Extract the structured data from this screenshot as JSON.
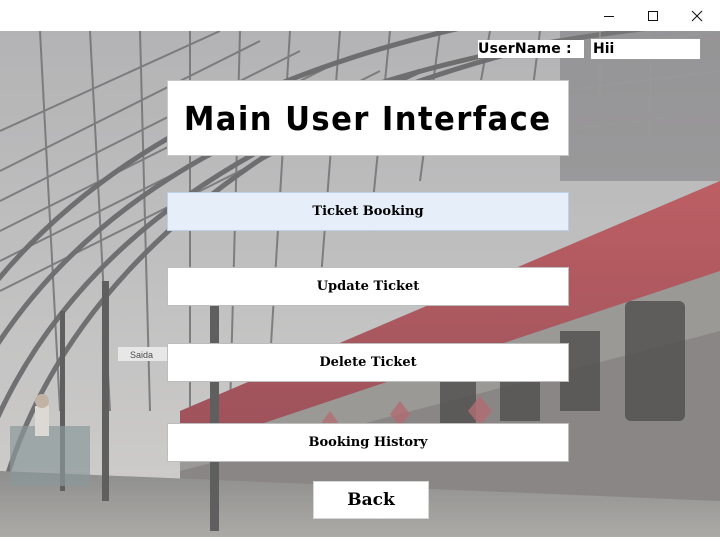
{
  "window": {
    "controls": {
      "minimize_icon": "minimize-icon",
      "maximize_icon": "maximize-icon",
      "close_icon": "close-icon"
    }
  },
  "header": {
    "username_label": "UserName :",
    "username_value": "Hii"
  },
  "main": {
    "title": "Main User Interface",
    "buttons": [
      {
        "label": "Ticket Booking"
      },
      {
        "label": "Update Ticket"
      },
      {
        "label": "Delete Ticket"
      },
      {
        "label": "Booking History"
      }
    ],
    "back_label": "Back"
  },
  "background": {
    "sign_text": "Saida",
    "colors": {
      "train_red": "#9a3e48",
      "roof": "#5e5d5f",
      "platform": "#8a8a88"
    }
  }
}
